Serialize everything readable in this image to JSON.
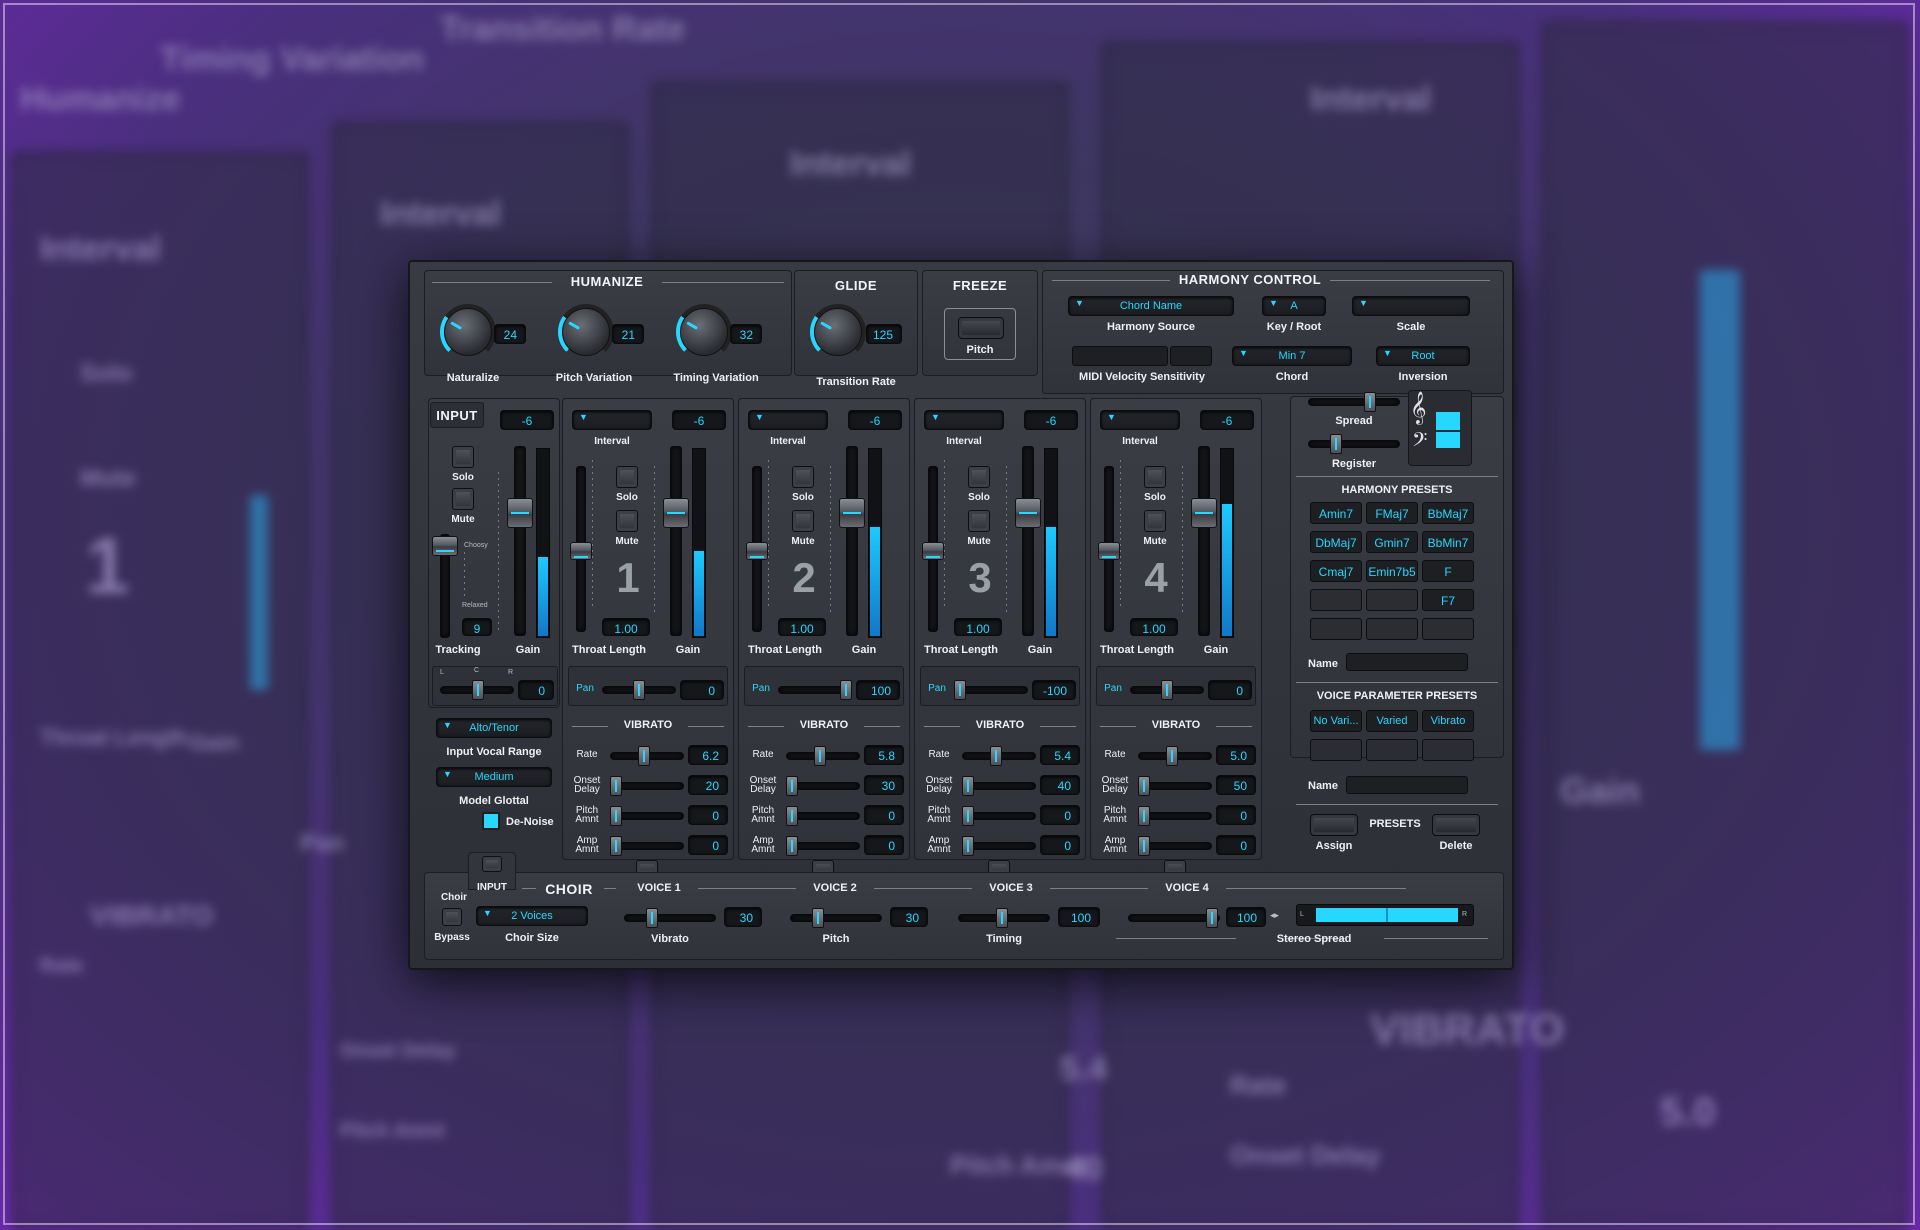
{
  "background": {
    "labels": [
      "Humanize",
      "Timing Variation",
      "Transition Rate",
      "Interval",
      "Interval",
      "Interval",
      "Interval",
      "Solo",
      "Mute",
      "1",
      "Throat Length",
      "Gain",
      "Gain",
      "VIBRATO",
      "VIBRATO",
      "Rate",
      "Onset Delay",
      "Pitch Amnt",
      "Rate",
      "Onset Delay",
      "Pitch Amnt",
      "5.4",
      "40",
      "5.0",
      "Pan"
    ]
  },
  "humanize": {
    "title": "HUMANIZE",
    "knobs": [
      {
        "label": "Naturalize",
        "value": "24"
      },
      {
        "label": "Pitch Variation",
        "value": "21"
      },
      {
        "label": "Timing Variation",
        "value": "32"
      }
    ]
  },
  "glide": {
    "title": "GLIDE",
    "label": "Transition Rate",
    "value": "125"
  },
  "freeze": {
    "title": "FREEZE",
    "label": "Pitch"
  },
  "harmony": {
    "title": "HARMONY CONTROL",
    "source": {
      "value": "Chord Name",
      "label": "Harmony Source"
    },
    "key": {
      "value": "A",
      "label": "Key / Root"
    },
    "scale": {
      "value": "",
      "label": "Scale"
    },
    "midi": {
      "label": "MIDI Velocity Sensitivity"
    },
    "chord": {
      "value": "Min 7",
      "label": "Chord"
    },
    "inversion": {
      "value": "Root",
      "label": "Inversion"
    },
    "spread": "Spread",
    "register": "Register",
    "clef_treble": "𝄞",
    "clef_bass": "𝄢"
  },
  "input": {
    "title": "INPUT",
    "gain_value": "-6",
    "solo": "Solo",
    "mute": "Mute",
    "choosy": "Choosy",
    "relaxed": "Relaxed",
    "tracking_value": "9",
    "tracking": "Tracking",
    "gain": "Gain",
    "pan_l": "L",
    "pan_c": "C",
    "pan_r": "R",
    "pan_value": "0",
    "range": {
      "value": "Alto/Tenor",
      "label": "Input Vocal Range"
    },
    "glottal": {
      "value": "Medium",
      "label": "Model Glottal"
    },
    "denoise": "De-Noise"
  },
  "voices": [
    {
      "num": "1",
      "gain_value": "-6",
      "interval": "Interval",
      "solo": "Solo",
      "mute": "Mute",
      "throat_value": "1.00",
      "throat": "Throat Length",
      "gain": "Gain",
      "pan": "Pan",
      "pan_value": "0",
      "vibrato": "VIBRATO",
      "rate": "Rate",
      "rate_value": "6.2",
      "onset": "Onset\nDelay",
      "onset_value": "20",
      "pitch": "Pitch\nAmnt",
      "pitch_value": "0",
      "amp": "Amp\nAmnt",
      "amp_value": "0",
      "meter": 0.45,
      "pan_pos": 0.5
    },
    {
      "num": "2",
      "gain_value": "-6",
      "interval": "Interval",
      "solo": "Solo",
      "mute": "Mute",
      "throat_value": "1.00",
      "throat": "Throat Length",
      "gain": "Gain",
      "pan": "Pan",
      "pan_value": "100",
      "vibrato": "VIBRATO",
      "rate": "Rate",
      "rate_value": "5.8",
      "onset": "Onset\nDelay",
      "onset_value": "30",
      "pitch": "Pitch\nAmnt",
      "pitch_value": "0",
      "amp": "Amp\nAmnt",
      "amp_value": "0",
      "meter": 0.58,
      "pan_pos": 1.0
    },
    {
      "num": "3",
      "gain_value": "-6",
      "interval": "Interval",
      "solo": "Solo",
      "mute": "Mute",
      "throat_value": "1.00",
      "throat": "Throat Length",
      "gain": "Gain",
      "pan": "Pan",
      "pan_value": "-100",
      "vibrato": "VIBRATO",
      "rate": "Rate",
      "rate_value": "5.4",
      "onset": "Onset\nDelay",
      "onset_value": "40",
      "pitch": "Pitch\nAmnt",
      "pitch_value": "0",
      "amp": "Amp\nAmnt",
      "amp_value": "0",
      "meter": 0.58,
      "pan_pos": 0.0
    },
    {
      "num": "4",
      "gain_value": "-6",
      "interval": "Interval",
      "solo": "Solo",
      "mute": "Mute",
      "throat_value": "1.00",
      "throat": "Throat Length",
      "gain": "Gain",
      "pan": "Pan",
      "pan_value": "0",
      "vibrato": "VIBRATO",
      "rate": "Rate",
      "rate_value": "5.0",
      "onset": "Onset\nDelay",
      "onset_value": "50",
      "pitch": "Pitch\nAmnt",
      "pitch_value": "0",
      "amp": "Amp\nAmnt",
      "amp_value": "0",
      "meter": 0.7,
      "pan_pos": 0.5
    }
  ],
  "harmony_presets": {
    "title": "HARMONY PRESETS",
    "items": [
      "Amin7",
      "FMaj7",
      "BbMaj7",
      "DbMaj7",
      "Gmin7",
      "BbMin7",
      "Cmaj7",
      "Emin7b5",
      "F",
      "",
      "",
      "F7",
      "",
      "",
      ""
    ],
    "name_label": "Name"
  },
  "voice_presets": {
    "title": "VOICE PARAMETER PRESETS",
    "items": [
      "No Vari...",
      "Varied",
      "Vibrato",
      "",
      "",
      ""
    ],
    "name_label": "Name"
  },
  "presets": {
    "label": "PRESETS",
    "assign": "Assign",
    "delete": "Delete"
  },
  "choir": {
    "title": "CHOIR",
    "input": "INPUT",
    "choir_label": "Choir",
    "bypass": "Bypass",
    "size": {
      "value": "2 Voices",
      "label": "Choir Size"
    },
    "voice_tabs": [
      "VOICE 1",
      "VOICE 2",
      "VOICE 3",
      "VOICE 4"
    ],
    "vibrato": {
      "label": "Vibrato",
      "value": "30"
    },
    "pitch": {
      "label": "Pitch",
      "value": "30"
    },
    "timing": {
      "label": "Timing",
      "value": "100"
    },
    "spread": {
      "label": "Stereo Spread",
      "value": "100",
      "l": "L",
      "r": "R"
    }
  },
  "colors": {
    "accent": "#27d7ff",
    "panel": "#33363c"
  }
}
